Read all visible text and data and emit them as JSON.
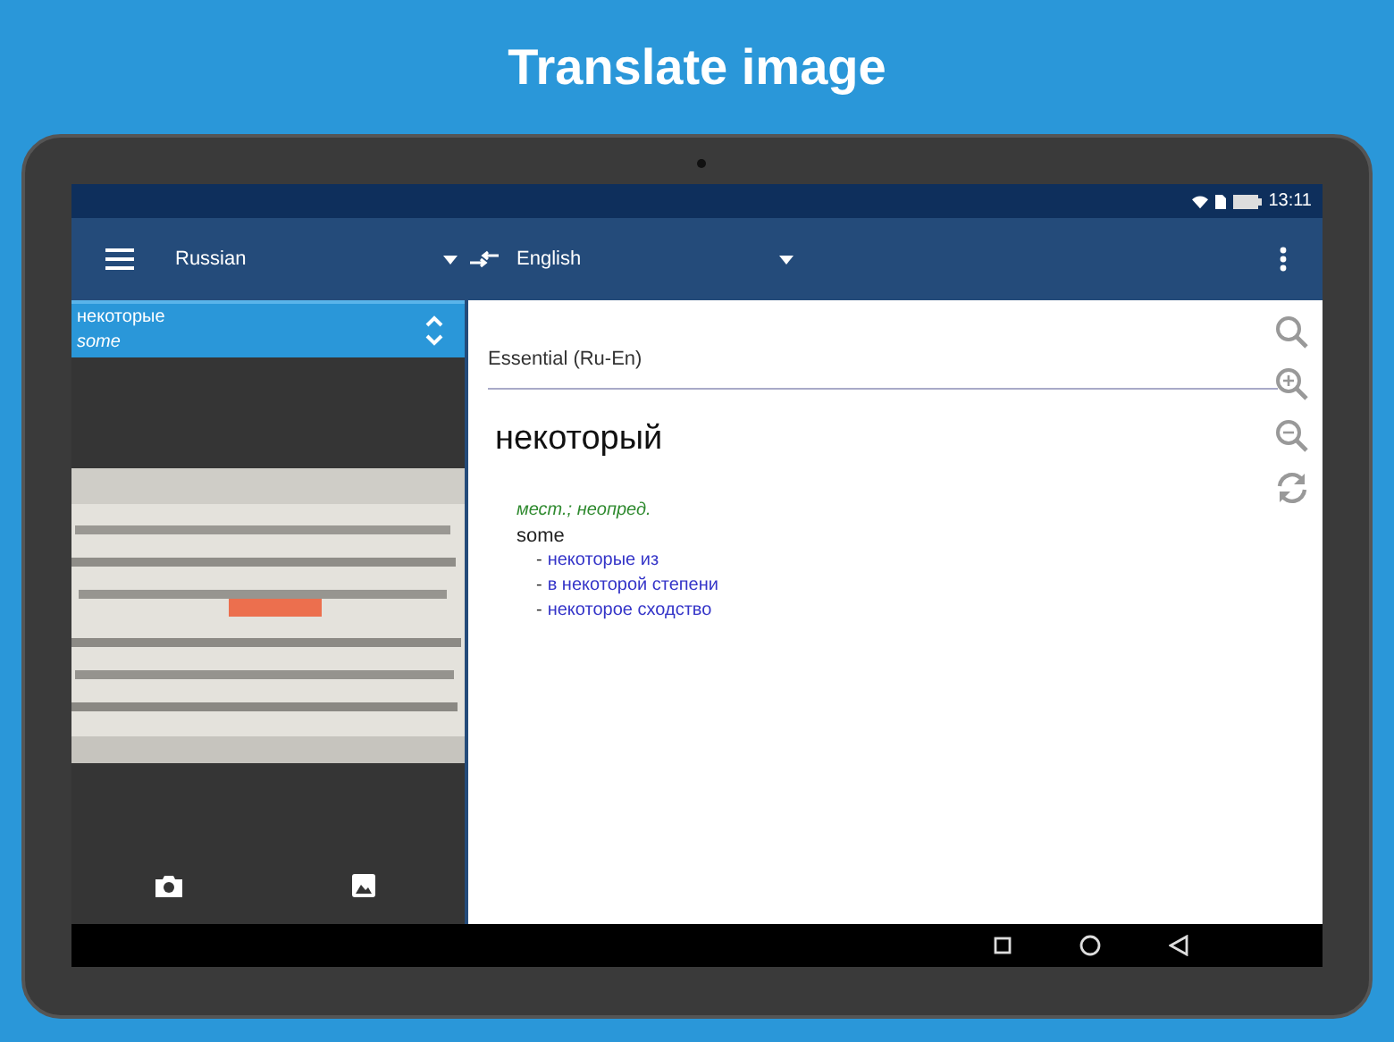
{
  "headline": "Translate image",
  "status_bar": {
    "time": "13:11"
  },
  "toolbar": {
    "source_language": "Russian",
    "target_language": "English"
  },
  "recognized": {
    "word": "некоторые",
    "translation": "some"
  },
  "dictionary": {
    "name": "Essential (Ru-En)",
    "headword": "некоторый",
    "part_of_speech": "мест.; неопред.",
    "translation": "some",
    "examples": [
      {
        "marker": "-",
        "text": "некоторые из"
      },
      {
        "marker": "-",
        "text": "в некоторой степени"
      },
      {
        "marker": "-",
        "text": "некоторое сходство"
      }
    ]
  }
}
